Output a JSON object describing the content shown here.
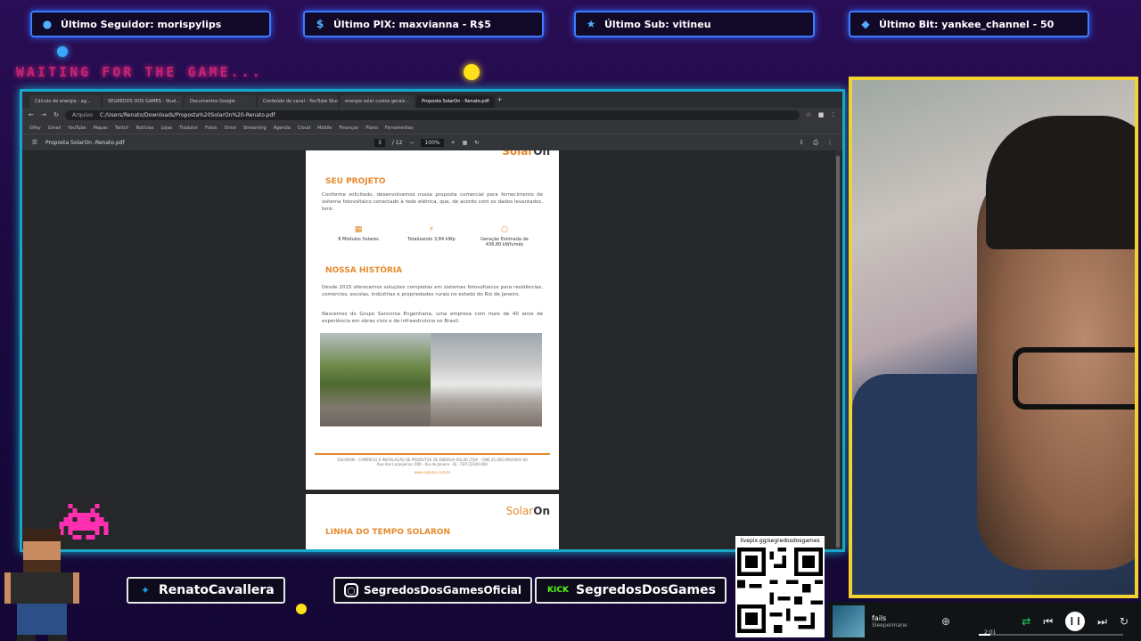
{
  "overlay": {
    "alerts": [
      {
        "icon": "user-icon",
        "text": "Último Seguidor: morispylips"
      },
      {
        "icon": "dollar-icon",
        "text": "Último PIX: maxvianna - R$5"
      },
      {
        "icon": "star-icon",
        "text": "Último Sub: vitineu"
      },
      {
        "icon": "diamond-icon",
        "text": "Último Bit: yankee_channel - 50"
      }
    ],
    "waiting_text": "WAITING FOR THE GAME...",
    "socials": [
      {
        "icon": "twitter-icon",
        "label": "RenatoCavallera"
      },
      {
        "icon": "instagram-icon",
        "label": "SegredosDosGamesOficial"
      },
      {
        "icon": "kick-icon",
        "badge": "KICK",
        "label": "SegredosDosGames"
      }
    ],
    "qr_caption": "livepix.gg/segredosdosgames"
  },
  "browser": {
    "tabs": [
      "Cálculo de energia - ag...",
      "SEGREDOS DOS GAMES - Stud...",
      "Documentos Google",
      "Conteúdo do canal - YouTube Studio",
      "energia solar custos gerais...",
      "Proposta SolarOn - Renato.pdf"
    ],
    "active_tab": 5,
    "address": "C:/Users/Renato/Downloads/Proposta%20SolarOn%20-Renato.pdf",
    "address_label": "Arquivo",
    "bookmarks": [
      "GPay",
      "Gmail",
      "YouTube",
      "Mapas",
      "Twitch",
      "Notícias",
      "Lojas",
      "Tradutor",
      "Fotos",
      "Drive",
      "Streaming",
      "Agenda",
      "Cloud",
      "Mobile",
      "Finanças",
      "Plano",
      "Ferramentas"
    ],
    "pdf": {
      "filename": "Proposta SolarOn -Renato.pdf",
      "page": "3",
      "page_total": "/ 12",
      "zoom": "100%"
    }
  },
  "document": {
    "brand_left": "Solar",
    "brand_right": "On",
    "section1_title": "SEU PROJETO",
    "section1_text": "Conforme solicitado, desenvolvemos nossa proposta comercial para fornecimento de sistema fotovoltaico conectado à rede elétrica, que, de acordo com os dados levantados, terá:",
    "stats": [
      {
        "icon": "solar-panel-icon",
        "label": "8 Módulos Solares"
      },
      {
        "icon": "lightning-icon",
        "label": "Totalizando 3,84 kWp"
      },
      {
        "icon": "sun-icon",
        "label": "Geração Estimada de 436,80 kWh/mês"
      }
    ],
    "section2_title": "NOSSA HISTÓRIA",
    "section2_text1": "Desde 2015 oferecemos soluções completas em sistemas fotovoltaicos para residências, comércios, escolas, indústrias e propriedades rurais no estado do Rio de Janeiro.",
    "section2_text2": "Nascemos do Grupo Sancorsa Engenharia, uma empresa com mais de 40 anos de experiência em obras civis e de infraestrutura no Brasil.",
    "footer_lines": [
      "SOLARON - COMÉRCIO E INSTALAÇÃO DE PRODUTOS DE ENERGIA SOLAR LTDA - CNPJ 25.000.000/0001-00",
      "Rua das Laranjeiras, 000 - Rio de Janeiro - RJ - CEP 22240-000",
      "www.solaron.com.br"
    ],
    "page2_title": "LINHA DO TEMPO SOLARON"
  },
  "music": {
    "title": "fails",
    "artist": "Sleepermane",
    "time": "2:01",
    "progress": 0.08
  }
}
